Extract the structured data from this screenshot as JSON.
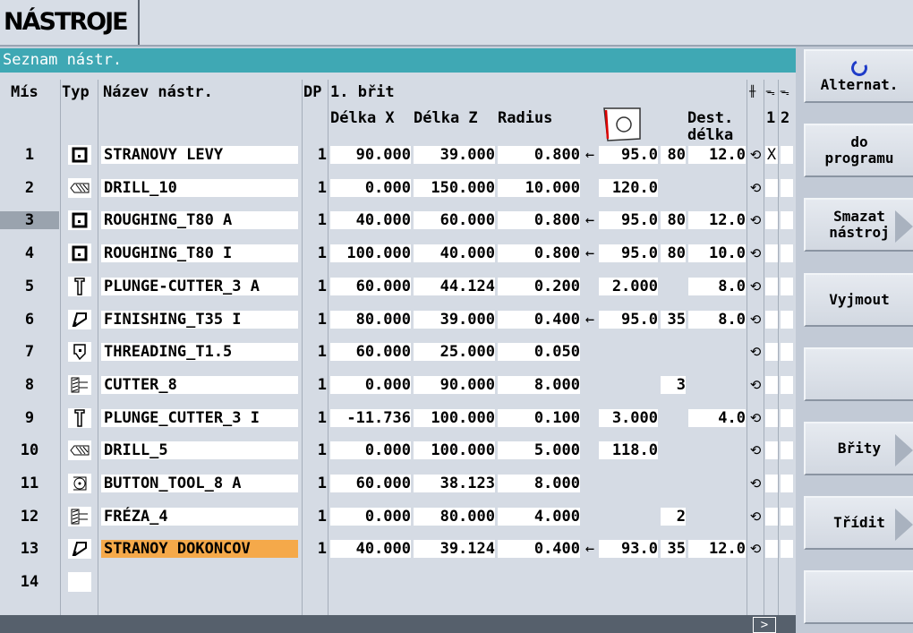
{
  "header": {
    "title": "NÁSTROJE"
  },
  "panel": {
    "title": "Seznam nástr."
  },
  "columns": {
    "mis": "Mís",
    "typ": "Typ",
    "name": "Název nástr.",
    "dp": "DP",
    "edge": "1. břit",
    "dx": "Délka X",
    "dz": "Délka Z",
    "radius": "Radius",
    "dest_line1": "Dest.",
    "dest_line2": "délka",
    "s1": "1",
    "s2": "2"
  },
  "rows": [
    {
      "num": "1",
      "type_icon": "turning-tool-icon",
      "name": "STRANOVY LEVY",
      "dp": "1",
      "dx": "90.000",
      "dz": "39.000",
      "radius": "0.800",
      "arrow": "←",
      "angle": "95.0",
      "angle2": "80",
      "dest": "12.0",
      "s1": "X"
    },
    {
      "num": "2",
      "type_icon": "drill-icon",
      "name": "DRILL_10",
      "dp": "1",
      "dx": "0.000",
      "dz": "150.000",
      "radius": "10.000",
      "arrow": "",
      "angle": "120.0",
      "angle2": "",
      "dest": "",
      "s1": ""
    },
    {
      "num": "3",
      "type_icon": "turning-tool-icon",
      "name": "ROUGHING_T80 A",
      "dp": "1",
      "dx": "40.000",
      "dz": "60.000",
      "radius": "0.800",
      "arrow": "←",
      "angle": "95.0",
      "angle2": "80",
      "dest": "12.0",
      "s1": ""
    },
    {
      "num": "4",
      "type_icon": "turning-tool-icon",
      "name": "ROUGHING_T80 I",
      "dp": "1",
      "dx": "100.000",
      "dz": "40.000",
      "radius": "0.800",
      "arrow": "←",
      "angle": "95.0",
      "angle2": "80",
      "dest": "10.0",
      "s1": ""
    },
    {
      "num": "5",
      "type_icon": "plunge-cutter-icon",
      "name": "PLUNGE-CUTTER_3 A",
      "dp": "1",
      "dx": "60.000",
      "dz": "44.124",
      "radius": "0.200",
      "arrow": "",
      "angle": "2.000",
      "angle2": "",
      "dest": "8.0",
      "s1": ""
    },
    {
      "num": "6",
      "type_icon": "finishing-tool-icon",
      "name": "FINISHING_T35 I",
      "dp": "1",
      "dx": "80.000",
      "dz": "39.000",
      "radius": "0.400",
      "arrow": "←",
      "angle": "95.0",
      "angle2": "35",
      "dest": "8.0",
      "s1": ""
    },
    {
      "num": "7",
      "type_icon": "threading-tool-icon",
      "name": "THREADING_T1.5",
      "dp": "1",
      "dx": "60.000",
      "dz": "25.000",
      "radius": "0.050",
      "arrow": "",
      "angle": "",
      "angle2": "",
      "dest": "",
      "s1": ""
    },
    {
      "num": "8",
      "type_icon": "cutter-icon",
      "name": "CUTTER_8",
      "dp": "1",
      "dx": "0.000",
      "dz": "90.000",
      "radius": "8.000",
      "arrow": "",
      "angle": "",
      "angle2": "3",
      "dest": "",
      "s1": ""
    },
    {
      "num": "9",
      "type_icon": "plunge-cutter-icon",
      "name": "PLUNGE_CUTTER_3 I",
      "dp": "1",
      "dx": "-11.736",
      "dz": "100.000",
      "radius": "0.100",
      "arrow": "",
      "angle": "3.000",
      "angle2": "",
      "dest": "4.0",
      "s1": ""
    },
    {
      "num": "10",
      "type_icon": "drill-icon",
      "name": "DRILL_5",
      "dp": "1",
      "dx": "0.000",
      "dz": "100.000",
      "radius": "5.000",
      "arrow": "",
      "angle": "118.0",
      "angle2": "",
      "dest": "",
      "s1": ""
    },
    {
      "num": "11",
      "type_icon": "button-tool-icon",
      "name": "BUTTON_TOOL_8 A",
      "dp": "1",
      "dx": "60.000",
      "dz": "38.123",
      "radius": "8.000",
      "arrow": "",
      "angle": "",
      "angle2": "",
      "dest": "",
      "s1": ""
    },
    {
      "num": "12",
      "type_icon": "cutter-icon",
      "name": "FRÉZA_4",
      "dp": "1",
      "dx": "0.000",
      "dz": "80.000",
      "radius": "4.000",
      "arrow": "",
      "angle": "",
      "angle2": "2",
      "dest": "",
      "s1": ""
    },
    {
      "num": "13",
      "type_icon": "finishing-tool-icon",
      "name": "STRANOY DOKONCOV",
      "dp": "1",
      "dx": "40.000",
      "dz": "39.124",
      "radius": "0.400",
      "arrow": "←",
      "angle": "93.0",
      "angle2": "35",
      "dest": "12.0",
      "s1": ""
    },
    {
      "num": "14",
      "type_icon": "",
      "name": "",
      "dp": "",
      "dx": "",
      "dz": "",
      "radius": "",
      "arrow": "",
      "angle": "",
      "angle2": "",
      "dest": "",
      "s1": ""
    }
  ],
  "selected_row": "3",
  "highlighted_row": "13",
  "softkeys": [
    {
      "label": "Alternat.",
      "icon": "cycle-icon"
    },
    {
      "label": "do programu"
    },
    {
      "label": "Smazat nástroj",
      "chevron": true
    },
    {
      "label": "Vyjmout"
    },
    {
      "label": ""
    },
    {
      "label": "Břity",
      "chevron": true
    },
    {
      "label": "Třídit",
      "chevron": true
    },
    {
      "label": ""
    }
  ],
  "colors": {
    "title_bar": "#3fa8b4",
    "highlight": "#f5a94a",
    "selection": "#9aa3ae",
    "icon_accent": "#1f3cc8"
  }
}
